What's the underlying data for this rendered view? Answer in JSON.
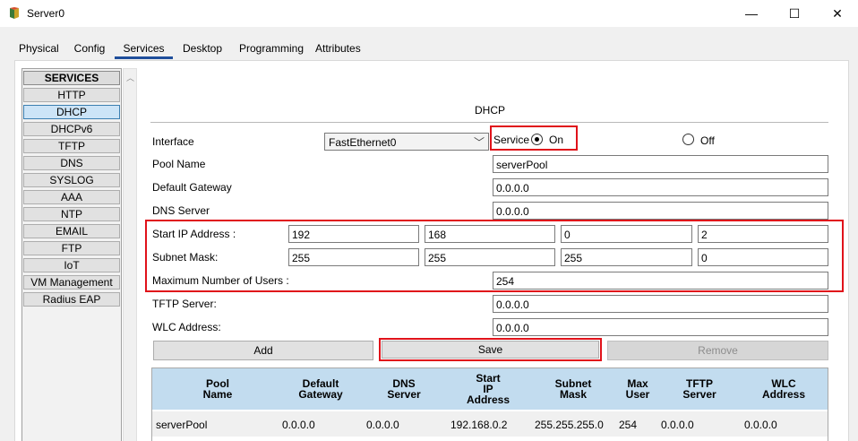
{
  "window": {
    "title": "Server0",
    "minimize": "—",
    "maximize": "☐",
    "close": "✕"
  },
  "tabs": [
    {
      "label": "Physical"
    },
    {
      "label": "Config"
    },
    {
      "label": "Services"
    },
    {
      "label": "Desktop"
    },
    {
      "label": "Programming"
    },
    {
      "label": "Attributes"
    }
  ],
  "active_tab": "Services",
  "sidebar": {
    "header": "SERVICES",
    "items": [
      {
        "label": "HTTP"
      },
      {
        "label": "DHCP"
      },
      {
        "label": "DHCPv6"
      },
      {
        "label": "TFTP"
      },
      {
        "label": "DNS"
      },
      {
        "label": "SYSLOG"
      },
      {
        "label": "AAA"
      },
      {
        "label": "NTP"
      },
      {
        "label": "EMAIL"
      },
      {
        "label": "FTP"
      },
      {
        "label": "IoT"
      },
      {
        "label": "VM Management"
      },
      {
        "label": "Radius EAP"
      }
    ],
    "selected": "DHCP"
  },
  "dhcp": {
    "title": "DHCP",
    "interface_label": "Interface",
    "interface_value": "FastEthernet0",
    "service_label": "Service",
    "service_on_label": "On",
    "service_off_label": "Off",
    "service_state": "On",
    "pool_name_label": "Pool Name",
    "pool_name_value": "serverPool",
    "default_gateway_label": "Default Gateway",
    "default_gateway_value": "0.0.0.0",
    "dns_server_label": "DNS Server",
    "dns_server_value": "0.0.0.0",
    "start_ip_label": "Start IP Address :",
    "start_ip": [
      "192",
      "168",
      "0",
      "2"
    ],
    "subnet_mask_label": "Subnet Mask:",
    "subnet_mask": [
      "255",
      "255",
      "255",
      "0"
    ],
    "max_users_label": "Maximum Number of Users :",
    "max_users_value": "254",
    "tftp_server_label": "TFTP Server:",
    "tftp_server_value": "0.0.0.0",
    "wlc_address_label": "WLC Address:",
    "wlc_address_value": "0.0.0.0",
    "add_button": "Add",
    "save_button": "Save",
    "remove_button": "Remove"
  },
  "pool_table": {
    "columns": [
      {
        "l1": "Pool",
        "l2": "Name",
        "l3": ""
      },
      {
        "l1": "Default",
        "l2": "Gateway",
        "l3": ""
      },
      {
        "l1": "DNS",
        "l2": "Server",
        "l3": ""
      },
      {
        "l1": "Start",
        "l2": "IP",
        "l3": "Address"
      },
      {
        "l1": "Subnet",
        "l2": "Mask",
        "l3": ""
      },
      {
        "l1": "Max",
        "l2": "User",
        "l3": ""
      },
      {
        "l1": "TFTP",
        "l2": "Server",
        "l3": ""
      },
      {
        "l1": "WLC",
        "l2": "Address",
        "l3": ""
      }
    ],
    "rows": [
      [
        "serverPool",
        "0.0.0.0",
        "0.0.0.0",
        "192.168.0.2",
        "255.255.255.0",
        "254",
        "0.0.0.0",
        "0.0.0.0"
      ]
    ]
  },
  "colors": {
    "highlight": "#e0121a",
    "table_header": "#c2dcef",
    "selected_item": "#cce4f7",
    "active_tab_underline": "#1f4e9b"
  }
}
